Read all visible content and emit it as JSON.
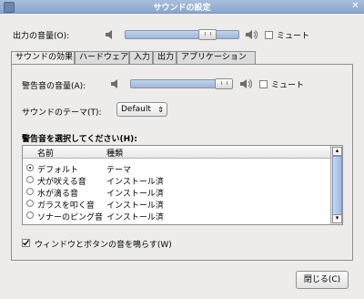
{
  "window": {
    "title": "サウンドの設定",
    "close_icon": "close-icon"
  },
  "output": {
    "label": "出力の音量(O):",
    "mute_label": "ミュート",
    "mute_checked": false,
    "volume_level": 0.68
  },
  "tabs": [
    {
      "label": "サウンドの効果",
      "active": true
    },
    {
      "label": "ハードウェア",
      "active": false
    },
    {
      "label": "入力",
      "active": false
    },
    {
      "label": "出力",
      "active": false
    },
    {
      "label": "アプリケーション",
      "active": false
    }
  ],
  "effects": {
    "alert_volume_label": "警告音の音量(A):",
    "alert_volume_level": 0.96,
    "alert_mute_label": "ミュート",
    "theme_label": "サウンドのテーマ(T):",
    "theme_value": "Default",
    "choose_label": "警告音を選択してください(H):",
    "columns": [
      "名前",
      "種類"
    ],
    "rows": [
      {
        "name": "デフォルト",
        "type": "テーマ",
        "selected": true
      },
      {
        "name": "犬が吠える音",
        "type": "インストール済",
        "selected": false
      },
      {
        "name": "水が滴る音",
        "type": "インストール済",
        "selected": false
      },
      {
        "name": "ガラスを叩く音",
        "type": "インストール済",
        "selected": false
      },
      {
        "name": "ソナーのピング音",
        "type": "インストール済",
        "selected": false
      }
    ],
    "window_sound_label": "ウィンドウとボタンの音を鳴らす(W)",
    "window_sound_checked": true
  },
  "footer": {
    "close_label": "閉じる(C)"
  }
}
